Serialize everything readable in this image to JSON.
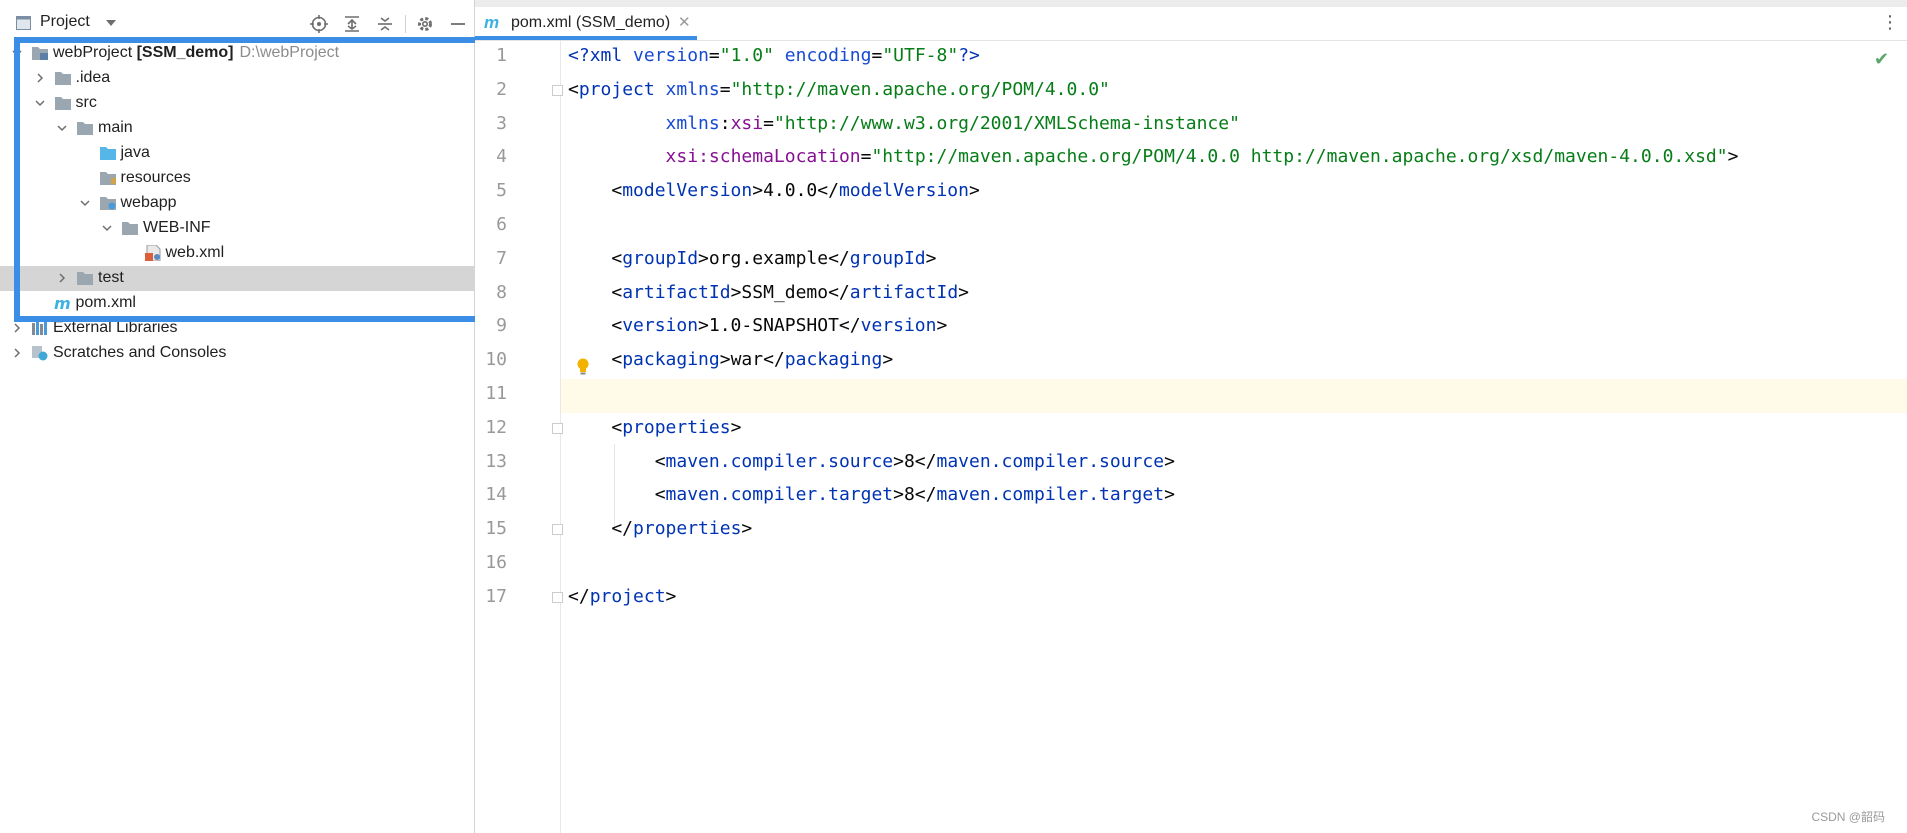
{
  "project_panel": {
    "title": "Project",
    "tree": [
      {
        "label": "webProject",
        "suffix": "[SSM_demo]",
        "path": "D:\\webProject",
        "icon": "module-folder-icon",
        "depth": 0,
        "arrow": "expanded"
      },
      {
        "label": ".idea",
        "icon": "folder-icon",
        "depth": 1,
        "arrow": "collapsed"
      },
      {
        "label": "src",
        "icon": "folder-icon",
        "depth": 1,
        "arrow": "expanded"
      },
      {
        "label": "main",
        "icon": "folder-icon",
        "depth": 2,
        "arrow": "expanded"
      },
      {
        "label": "java",
        "icon": "source-folder-icon",
        "depth": 3,
        "arrow": "none"
      },
      {
        "label": "resources",
        "icon": "resources-folder-icon",
        "depth": 3,
        "arrow": "none"
      },
      {
        "label": "webapp",
        "icon": "web-folder-icon",
        "depth": 3,
        "arrow": "expanded"
      },
      {
        "label": "WEB-INF",
        "icon": "folder-icon",
        "depth": 4,
        "arrow": "expanded"
      },
      {
        "label": "web.xml",
        "icon": "web-xml-file-icon",
        "depth": 5,
        "arrow": "none"
      },
      {
        "label": "test",
        "icon": "folder-icon",
        "depth": 2,
        "arrow": "collapsed",
        "selected": true
      },
      {
        "label": "pom.xml",
        "icon": "maven-file-icon",
        "depth": 1,
        "arrow": "none"
      },
      {
        "label": "External Libraries",
        "icon": "libraries-icon",
        "depth": 0,
        "arrow": "collapsed"
      },
      {
        "label": "Scratches and Consoles",
        "icon": "scratches-icon",
        "depth": 0,
        "arrow": "collapsed"
      }
    ]
  },
  "editor": {
    "tab_label": "pom.xml (SSM_demo)",
    "tab_icon": "m",
    "line_numbers": [
      "1",
      "2",
      "3",
      "4",
      "5",
      "6",
      "7",
      "8",
      "9",
      "10",
      "11",
      "12",
      "13",
      "14",
      "15",
      "16",
      "17"
    ],
    "lines": [
      [
        {
          "t": "<?",
          "c": "t-tag"
        },
        {
          "t": "xml ",
          "c": "t-tag"
        },
        {
          "t": "version",
          "c": "t-attr"
        },
        {
          "t": "=",
          "c": "t-text"
        },
        {
          "t": "\"1.0\"",
          "c": "t-str"
        },
        {
          "t": " encoding",
          "c": "t-attr"
        },
        {
          "t": "=",
          "c": "t-text"
        },
        {
          "t": "\"UTF-8\"",
          "c": "t-str"
        },
        {
          "t": "?>",
          "c": "t-tag"
        }
      ],
      [
        {
          "t": "<",
          "c": "t-text"
        },
        {
          "t": "project ",
          "c": "t-tag"
        },
        {
          "t": "xmlns",
          "c": "t-attr"
        },
        {
          "t": "=",
          "c": "t-text"
        },
        {
          "t": "\"http://maven.apache.org/POM/4.0.0\"",
          "c": "t-str"
        }
      ],
      [
        {
          "t": "         ",
          "c": "t-text"
        },
        {
          "t": "xmlns",
          "c": "t-attr"
        },
        {
          "t": ":",
          "c": "t-text"
        },
        {
          "t": "xsi",
          "c": "t-ns"
        },
        {
          "t": "=",
          "c": "t-text"
        },
        {
          "t": "\"http://www.w3.org/2001/XMLSchema-instance\"",
          "c": "t-str"
        }
      ],
      [
        {
          "t": "         ",
          "c": "t-text"
        },
        {
          "t": "xsi",
          "c": "t-ns"
        },
        {
          "t": ":schemaLocation",
          "c": "t-ns"
        },
        {
          "t": "=",
          "c": "t-text"
        },
        {
          "t": "\"http://maven.apache.org/POM/4.0.0 http://maven.apache.org/xsd/maven-4.0.0.xsd\"",
          "c": "t-str"
        },
        {
          "t": ">",
          "c": "t-text"
        }
      ],
      [
        {
          "t": "    <",
          "c": "t-text"
        },
        {
          "t": "modelVersion",
          "c": "t-tag"
        },
        {
          "t": ">4.0.0</",
          "c": "t-text"
        },
        {
          "t": "modelVersion",
          "c": "t-tag"
        },
        {
          "t": ">",
          "c": "t-text"
        }
      ],
      [],
      [
        {
          "t": "    <",
          "c": "t-text"
        },
        {
          "t": "groupId",
          "c": "t-tag"
        },
        {
          "t": ">org.example</",
          "c": "t-text"
        },
        {
          "t": "groupId",
          "c": "t-tag"
        },
        {
          "t": ">",
          "c": "t-text"
        }
      ],
      [
        {
          "t": "    <",
          "c": "t-text"
        },
        {
          "t": "artifactId",
          "c": "t-tag"
        },
        {
          "t": ">SSM_demo</",
          "c": "t-text"
        },
        {
          "t": "artifactId",
          "c": "t-tag"
        },
        {
          "t": ">",
          "c": "t-text"
        }
      ],
      [
        {
          "t": "    <",
          "c": "t-text"
        },
        {
          "t": "version",
          "c": "t-tag"
        },
        {
          "t": ">1.0-SNAPSHOT</",
          "c": "t-text"
        },
        {
          "t": "version",
          "c": "t-tag"
        },
        {
          "t": ">",
          "c": "t-text"
        }
      ],
      [
        {
          "t": "    <",
          "c": "t-text"
        },
        {
          "t": "packaging",
          "c": "t-tag"
        },
        {
          "t": ">war</",
          "c": "t-text"
        },
        {
          "t": "packaging",
          "c": "t-tag"
        },
        {
          "t": ">",
          "c": "t-text"
        }
      ],
      [],
      [
        {
          "t": "    <",
          "c": "t-text"
        },
        {
          "t": "properties",
          "c": "t-tag"
        },
        {
          "t": ">",
          "c": "t-text"
        }
      ],
      [
        {
          "t": "        <",
          "c": "t-text"
        },
        {
          "t": "maven.compiler.source",
          "c": "t-tag"
        },
        {
          "t": ">8</",
          "c": "t-text"
        },
        {
          "t": "maven.compiler.source",
          "c": "t-tag"
        },
        {
          "t": ">",
          "c": "t-text"
        }
      ],
      [
        {
          "t": "        <",
          "c": "t-text"
        },
        {
          "t": "maven.compiler.target",
          "c": "t-tag"
        },
        {
          "t": ">8</",
          "c": "t-text"
        },
        {
          "t": "maven.compiler.target",
          "c": "t-tag"
        },
        {
          "t": ">",
          "c": "t-text"
        }
      ],
      [
        {
          "t": "    </",
          "c": "t-text"
        },
        {
          "t": "properties",
          "c": "t-tag"
        },
        {
          "t": ">",
          "c": "t-text"
        }
      ],
      [],
      [
        {
          "t": "</",
          "c": "t-text"
        },
        {
          "t": "project",
          "c": "t-tag"
        },
        {
          "t": ">",
          "c": "t-text"
        }
      ]
    ],
    "current_line": 11
  },
  "watermark": "CSDN @韶码",
  "colors": {
    "highlight_box": "#3a8ee6",
    "selection": "#d5d5d5",
    "current_line": "#fffbe8"
  }
}
